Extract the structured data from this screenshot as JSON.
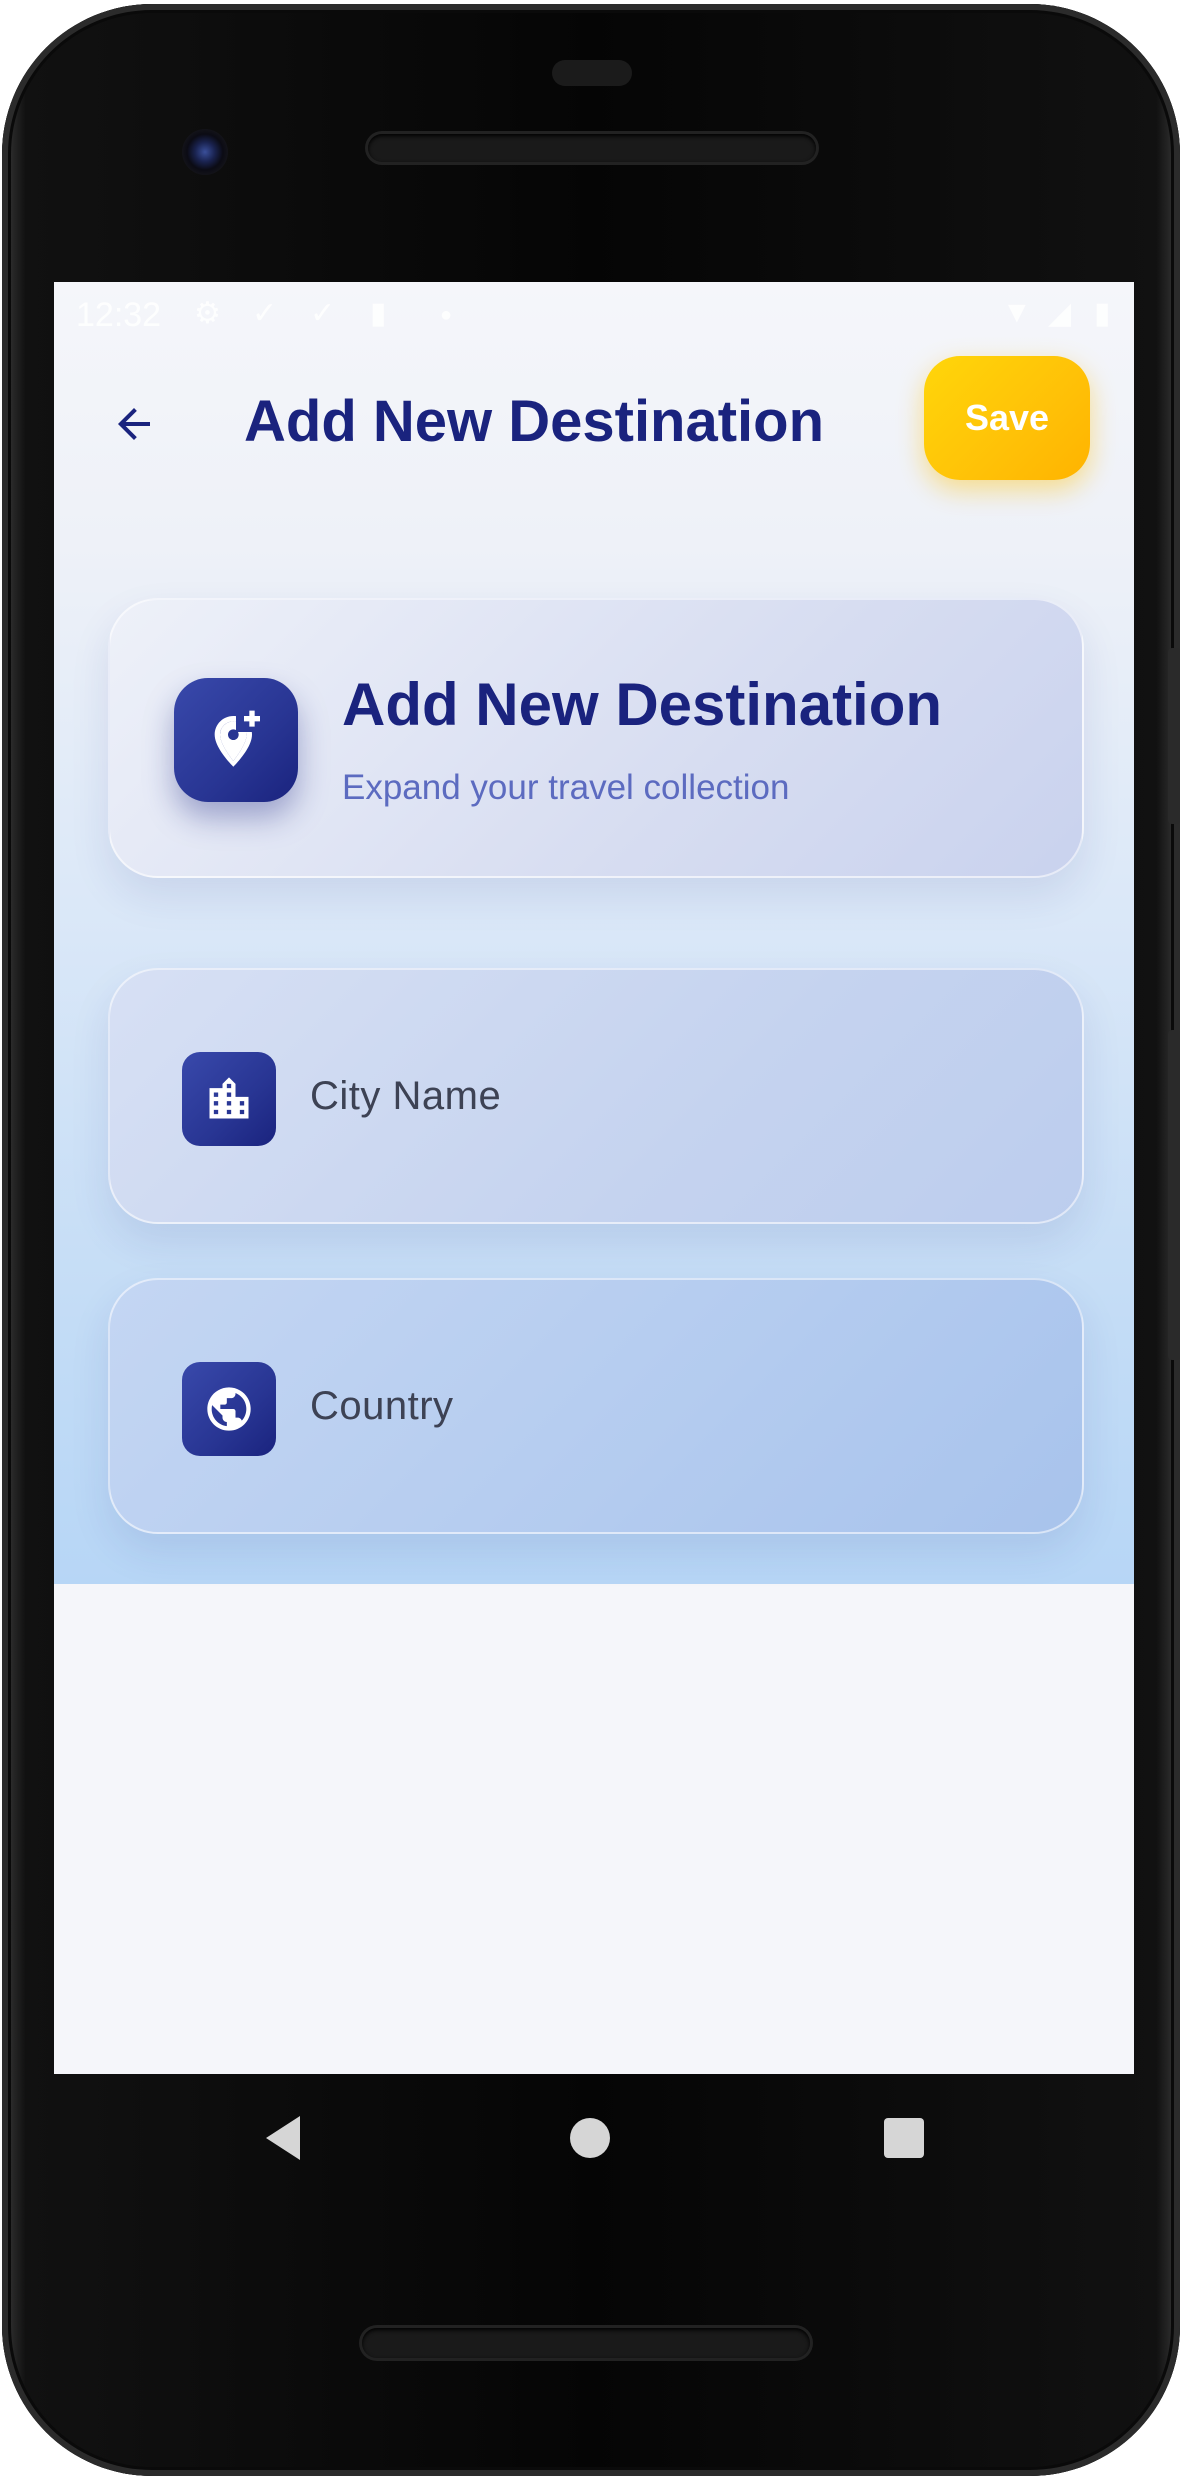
{
  "statusbar": {
    "time": "12:32",
    "icons": [
      "settings-icon",
      "download-done-icon",
      "download-done-icon",
      "sd-card-icon",
      "dot-icon",
      "wifi-icon",
      "signal-icon",
      "battery-icon"
    ]
  },
  "appbar": {
    "title": "Add New Destination",
    "back_icon": "arrow-back-icon",
    "save_label": "Save"
  },
  "header_card": {
    "icon": "add-location-icon",
    "title": "Add New Destination",
    "subtitle": "Expand your travel collection"
  },
  "form": {
    "fields": [
      {
        "icon": "city-icon",
        "placeholder": "City Name",
        "value": ""
      },
      {
        "icon": "globe-icon",
        "placeholder": "Country",
        "value": ""
      }
    ]
  },
  "colors": {
    "primary": "#1a237e",
    "accent": "#ffc107",
    "subtitle": "#5c6bc0"
  },
  "navigation": {
    "buttons": [
      "back-triangle-icon",
      "home-circle-icon",
      "recents-square-icon"
    ]
  }
}
